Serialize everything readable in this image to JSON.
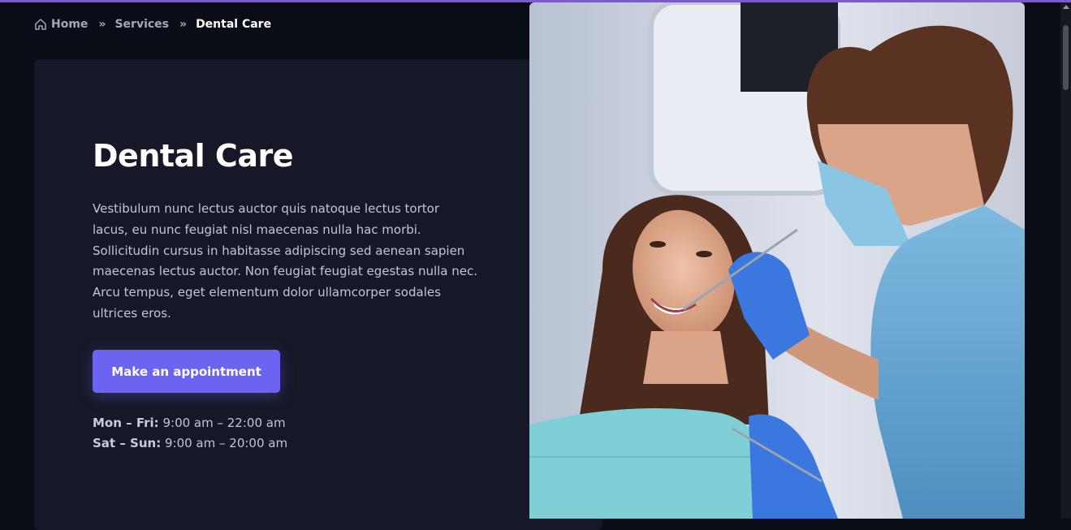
{
  "breadcrumb": {
    "home": "Home",
    "separator": "»",
    "services": "Services",
    "current": "Dental Care"
  },
  "hero": {
    "title": "Dental Care",
    "description": "Vestibulum nunc lectus auctor quis natoque lectus tortor lacus, eu nunc feugiat nisl maecenas nulla hac morbi. Sollicitudin cursus in habitasse adipiscing sed aenean sapien maecenas lectus auctor. Non feugiat feugiat egestas nulla nec. Arcu tempus, eget elementum dolor ullamcorper sodales ultrices eros.",
    "cta_label": "Make an appointment",
    "hours": [
      {
        "days": "Mon – Fri:",
        "time": "9:00 am – 22:00 am"
      },
      {
        "days": "Sat – Sun:",
        "time": "9:00 am – 20:00 am"
      }
    ]
  },
  "icons": {
    "home": "home-icon"
  },
  "colors": {
    "accent": "#6c63f0",
    "top_bar": "#7b5cc4",
    "background": "#0b0d16",
    "card": "#161827"
  }
}
